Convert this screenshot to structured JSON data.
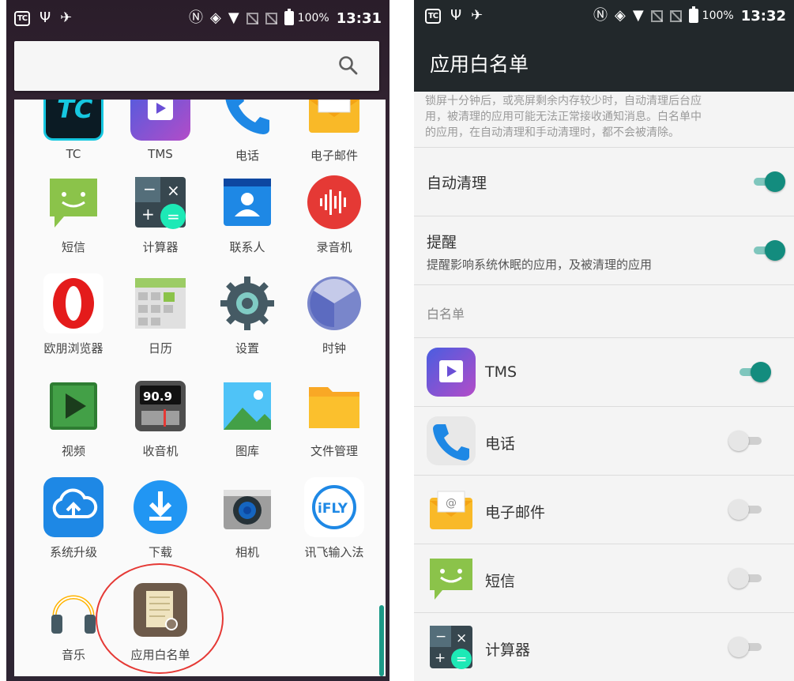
{
  "left": {
    "status": {
      "pct": "100%",
      "time": "13:31"
    },
    "apps": [
      {
        "label": "TC",
        "icon": "tc-icon"
      },
      {
        "label": "TMS",
        "icon": "tms-icon"
      },
      {
        "label": "电话",
        "icon": "phone-icon"
      },
      {
        "label": "电子邮件",
        "icon": "email-icon"
      },
      {
        "label": "短信",
        "icon": "sms-icon"
      },
      {
        "label": "计算器",
        "icon": "calculator-icon"
      },
      {
        "label": "联系人",
        "icon": "contacts-icon"
      },
      {
        "label": "录音机",
        "icon": "recorder-icon"
      },
      {
        "label": "欧朋浏览器",
        "icon": "opera-icon"
      },
      {
        "label": "日历",
        "icon": "calendar-icon"
      },
      {
        "label": "设置",
        "icon": "settings-icon"
      },
      {
        "label": "时钟",
        "icon": "clock-icon"
      },
      {
        "label": "视频",
        "icon": "video-icon"
      },
      {
        "label": "收音机",
        "icon": "radio-icon",
        "radio_display": "90.9"
      },
      {
        "label": "图库",
        "icon": "gallery-icon"
      },
      {
        "label": "文件管理",
        "icon": "files-icon"
      },
      {
        "label": "系统升级",
        "icon": "system-update-icon"
      },
      {
        "label": "下载",
        "icon": "download-icon"
      },
      {
        "label": "相机",
        "icon": "camera-icon"
      },
      {
        "label": "讯飞输入法",
        "icon": "ifly-icon",
        "badge": "iFLY"
      },
      {
        "label": "音乐",
        "icon": "music-icon"
      },
      {
        "label": "应用白名单",
        "icon": "whitelist-icon"
      }
    ]
  },
  "right": {
    "status": {
      "pct": "100%",
      "time": "13:32"
    },
    "title": "应用白名单",
    "description": "锁屏十分钟后，或亮屏剩余内存较少时，自动清理后台应\n用，被清理的应用可能无法正常接收通知消息。白名单中\n的应用，在自动清理和手动清理时，都不会被清除。",
    "auto_clean": {
      "label": "自动清理",
      "on": true
    },
    "remind": {
      "label": "提醒",
      "sub": "提醒影响系统休眠的应用，及被清理的应用",
      "on": true
    },
    "section_label": "白名单",
    "whitelist": [
      {
        "label": "TMS",
        "icon": "tms-icon",
        "on": true
      },
      {
        "label": "电话",
        "icon": "phone-icon",
        "on": false
      },
      {
        "label": "电子邮件",
        "icon": "email-icon",
        "on": false
      },
      {
        "label": "短信",
        "icon": "sms-icon",
        "on": false
      },
      {
        "label": "计算器",
        "icon": "calculator-icon",
        "on": false
      }
    ]
  }
}
